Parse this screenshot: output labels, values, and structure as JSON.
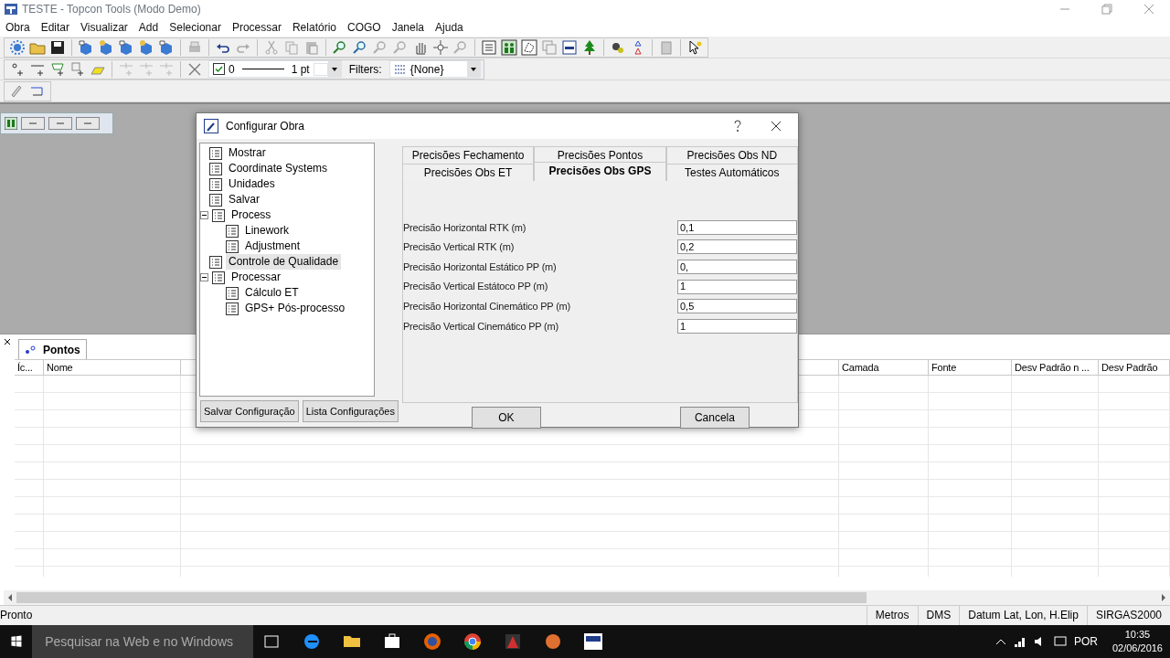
{
  "window": {
    "title": "TESTE - Topcon Tools (Modo Demo)"
  },
  "menu": [
    "Obra",
    "Editar",
    "Visualizar",
    "Add",
    "Selecionar",
    "Processar",
    "Relatório",
    "COGO",
    "Janela",
    "Ajuda"
  ],
  "toolbar": {
    "line_style": {
      "checked": true,
      "value": "0",
      "weight": "1 pt"
    },
    "filters_label": "Filters:",
    "filter": "{None}"
  },
  "points_panel": {
    "tab": "Pontos",
    "columns": [
      {
        "label": "Íc..."
      },
      {
        "label": "Nome"
      },
      {
        "label": "Camada"
      },
      {
        "label": "Fonte"
      },
      {
        "label": "Desv Padrão n ..."
      },
      {
        "label": "Desv Padrão"
      }
    ]
  },
  "dialog": {
    "title": "Configurar Obra",
    "tree": [
      {
        "label": "Mostrar",
        "selected": false
      },
      {
        "label": "Coordinate Systems",
        "selected": false
      },
      {
        "label": "Unidades",
        "selected": false
      },
      {
        "label": "Salvar",
        "selected": false
      },
      {
        "label": "Process",
        "selected": false,
        "expanded": true,
        "children": [
          {
            "label": "Linework",
            "selected": false
          },
          {
            "label": "Adjustment",
            "selected": false
          }
        ]
      },
      {
        "label": "Controle de Qualidade",
        "selected": true
      },
      {
        "label": "Processar",
        "selected": false,
        "expanded": true,
        "children": [
          {
            "label": "Cálculo ET",
            "selected": false
          },
          {
            "label": "GPS+ Pós-processo",
            "selected": false
          }
        ]
      }
    ],
    "tab_rows": [
      [
        {
          "label": "Precisões Fechamento",
          "selected": false
        },
        {
          "label": "Precisões Pontos",
          "selected": false
        },
        {
          "label": "Precisões Obs ND",
          "selected": false
        }
      ],
      [
        {
          "label": "Precisões Obs ET",
          "selected": false
        },
        {
          "label": "Precisões Obs GPS",
          "selected": true
        },
        {
          "label": "Testes Automáticos",
          "selected": false
        }
      ]
    ],
    "fields": [
      {
        "label": "Precisão Horizontal RTK (m)",
        "value": "0,1"
      },
      {
        "label": "Precisão Vertical RTK (m)",
        "value": "0,2"
      },
      {
        "label": "Precisão Horizontal Estático PP (m)",
        "value": "0,"
      },
      {
        "label": "Precisão Vertical Estátoco PP (m)",
        "value": "1"
      },
      {
        "label": "Precisão Horizontal Cinemático PP (m)",
        "value": "0,5"
      },
      {
        "label": "Precisão Vertical Cinemático PP (m)",
        "value": "1"
      }
    ],
    "left_buttons": [
      "Salvar Configuração",
      "Lista Configurações"
    ],
    "ok": "OK",
    "cancel": "Cancela"
  },
  "status_bar": {
    "text": "Pronto",
    "panels": [
      "Metros",
      "DMS",
      "Datum Lat, Lon, H.Elip",
      "SIRGAS2000"
    ]
  },
  "taskbar": {
    "search_placeholder": "Pesquisar na Web e no Windows",
    "language": "POR",
    "time": "10:35",
    "date": "02/06/2016"
  }
}
